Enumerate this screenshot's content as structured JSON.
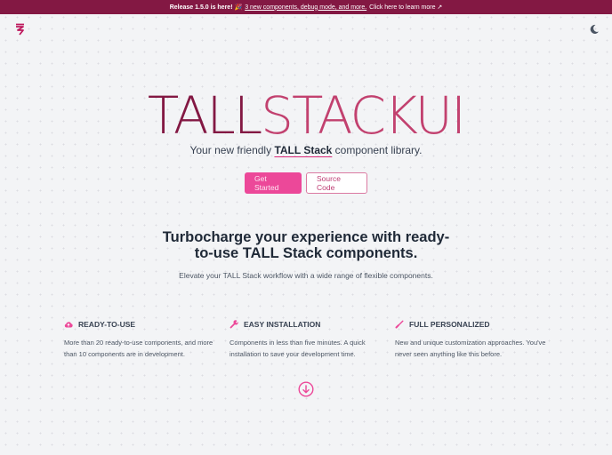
{
  "banner": {
    "lead": "Release 1.5.0 is here! 🎉",
    "link": "3 new components, debug mode, and more.",
    "tail": "Click here to learn more ↗"
  },
  "header": {
    "logo_icon": "tallstackui-logo-icon",
    "theme_icon": "moon-icon"
  },
  "hero": {
    "title_part1": "TALL",
    "title_part2": "STACKUI",
    "tagline_before": "Your new friendly ",
    "tagline_highlight": "TALL Stack",
    "tagline_after": " component library.",
    "primary_button": "Get Started",
    "secondary_button": "Source Code"
  },
  "section": {
    "heading_line1": "Turbocharge your experience with ready-",
    "heading_line2": "to-use TALL Stack components.",
    "subheading": "Elevate your TALL Stack workflow with a wide range of flexible components."
  },
  "features": [
    {
      "icon": "cloud-upload-icon",
      "title": "READY-TO-USE",
      "description": "More than 20 ready-to-use components, and more than 10 components are in development."
    },
    {
      "icon": "wrench-icon",
      "title": "EASY INSTALLATION",
      "description": "Components in less than five minutes. A quick installation to save your development time."
    },
    {
      "icon": "paint-brush-icon",
      "title": "FULL PERSONALIZED",
      "description": "New and unique customization approaches. You've never seen anything like this before."
    }
  ],
  "colors": {
    "brand_dark": "#831843",
    "brand": "#c2416f",
    "accent": "#ec4899"
  }
}
